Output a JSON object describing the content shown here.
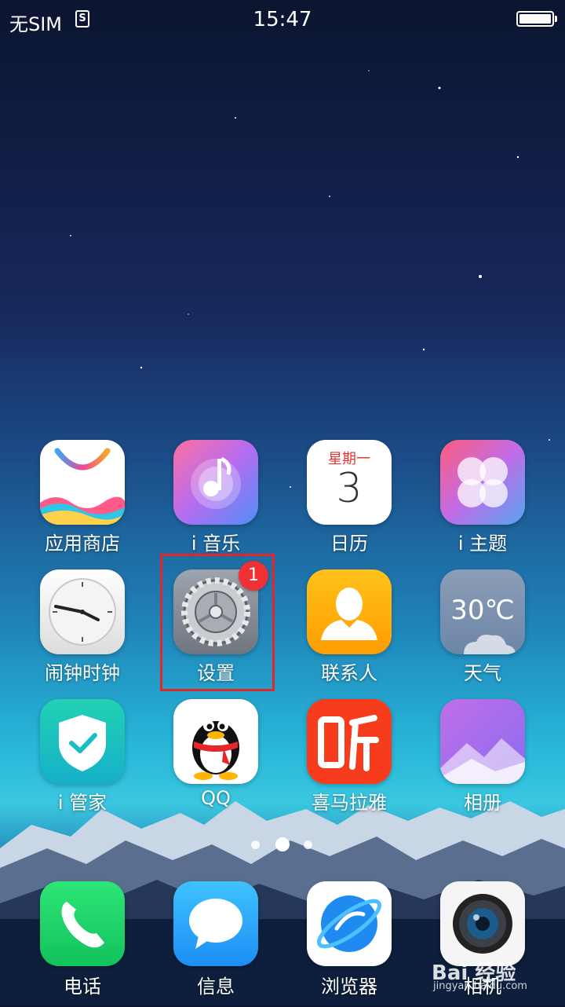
{
  "status_bar": {
    "sim_text": "无SIM",
    "sim_icon": "S",
    "time": "15:47",
    "battery_level": 1.0
  },
  "home": {
    "apps": [
      {
        "label": "应用商店",
        "icon": "app-store-icon"
      },
      {
        "label": "i 音乐",
        "icon": "music-icon"
      },
      {
        "label": "日历",
        "icon": "calendar-icon",
        "weekday": "星期一",
        "day": "3"
      },
      {
        "label": "i 主题",
        "icon": "theme-icon"
      },
      {
        "label": "闹钟时钟",
        "icon": "clock-icon"
      },
      {
        "label": "设置",
        "icon": "gear-icon",
        "badge": "1"
      },
      {
        "label": "联系人",
        "icon": "contacts-icon"
      },
      {
        "label": "天气",
        "icon": "weather-icon",
        "temperature": "30℃"
      },
      {
        "label": "i 管家",
        "icon": "shield-icon"
      },
      {
        "label": "QQ",
        "icon": "qq-penguin-icon"
      },
      {
        "label": "喜马拉雅",
        "icon": "ximalaya-icon"
      },
      {
        "label": "相册",
        "icon": "gallery-icon"
      }
    ],
    "page_indicator": {
      "pages": 3,
      "current": 2
    }
  },
  "dock": {
    "apps": [
      {
        "label": "电话",
        "icon": "phone-icon"
      },
      {
        "label": "信息",
        "icon": "message-icon"
      },
      {
        "label": "浏览器",
        "icon": "browser-icon"
      },
      {
        "label": "相机",
        "icon": "camera-icon"
      }
    ]
  },
  "watermark": {
    "text": "Bai 经验",
    "url": "jingyan.baidu.com"
  },
  "colors": {
    "badge": "#ef3034",
    "highlight_box": "#e0282b"
  }
}
